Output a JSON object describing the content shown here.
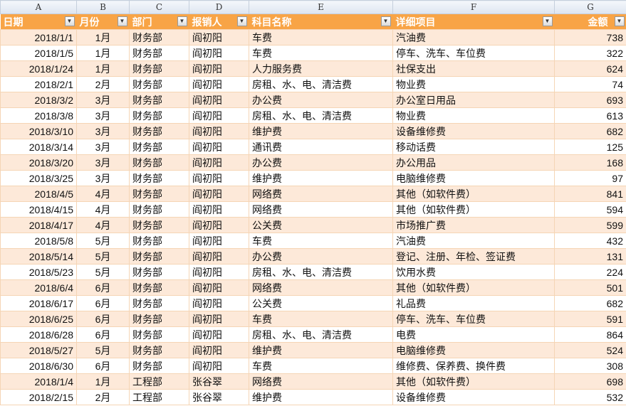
{
  "column_letters": [
    "A",
    "B",
    "C",
    "D",
    "E",
    "F",
    "G"
  ],
  "headers": [
    "日期",
    "月份",
    "部门",
    "报销人",
    "科目名称",
    "详细项目",
    "金额"
  ],
  "rows": [
    [
      "2018/1/1",
      "1月",
      "财务部",
      "阎初阳",
      "车费",
      "汽油费",
      "738"
    ],
    [
      "2018/1/5",
      "1月",
      "财务部",
      "阎初阳",
      "车费",
      "停车、洗车、车位费",
      "322"
    ],
    [
      "2018/1/24",
      "1月",
      "财务部",
      "阎初阳",
      "人力服务费",
      "社保支出",
      "624"
    ],
    [
      "2018/2/1",
      "2月",
      "财务部",
      "阎初阳",
      "房租、水、电、清洁费",
      "物业费",
      "74"
    ],
    [
      "2018/3/2",
      "3月",
      "财务部",
      "阎初阳",
      "办公费",
      "办公室日用品",
      "693"
    ],
    [
      "2018/3/8",
      "3月",
      "财务部",
      "阎初阳",
      "房租、水、电、清洁费",
      "物业费",
      "613"
    ],
    [
      "2018/3/10",
      "3月",
      "财务部",
      "阎初阳",
      "维护费",
      "设备维修费",
      "682"
    ],
    [
      "2018/3/14",
      "3月",
      "财务部",
      "阎初阳",
      "通讯费",
      "移动话费",
      "125"
    ],
    [
      "2018/3/20",
      "3月",
      "财务部",
      "阎初阳",
      "办公费",
      "办公用品",
      "168"
    ],
    [
      "2018/3/25",
      "3月",
      "财务部",
      "阎初阳",
      "维护费",
      "电脑维修费",
      "97"
    ],
    [
      "2018/4/5",
      "4月",
      "财务部",
      "阎初阳",
      "网络费",
      "其他（如软件费）",
      "841"
    ],
    [
      "2018/4/15",
      "4月",
      "财务部",
      "阎初阳",
      "网络费",
      "其他（如软件费）",
      "594"
    ],
    [
      "2018/4/17",
      "4月",
      "财务部",
      "阎初阳",
      "公关费",
      "市场推广费",
      "599"
    ],
    [
      "2018/5/8",
      "5月",
      "财务部",
      "阎初阳",
      "车费",
      "汽油费",
      "432"
    ],
    [
      "2018/5/14",
      "5月",
      "财务部",
      "阎初阳",
      "办公费",
      "登记、注册、年检、签证费",
      "131"
    ],
    [
      "2018/5/23",
      "5月",
      "财务部",
      "阎初阳",
      "房租、水、电、清洁费",
      "饮用水费",
      "224"
    ],
    [
      "2018/6/4",
      "6月",
      "财务部",
      "阎初阳",
      "网络费",
      "其他（如软件费）",
      "501"
    ],
    [
      "2018/6/17",
      "6月",
      "财务部",
      "阎初阳",
      "公关费",
      "礼品费",
      "682"
    ],
    [
      "2018/6/25",
      "6月",
      "财务部",
      "阎初阳",
      "车费",
      "停车、洗车、车位费",
      "591"
    ],
    [
      "2018/6/28",
      "6月",
      "财务部",
      "阎初阳",
      "房租、水、电、清洁费",
      "电费",
      "864"
    ],
    [
      "2018/5/27",
      "5月",
      "财务部",
      "阎初阳",
      "维护费",
      "电脑维修费",
      "524"
    ],
    [
      "2018/6/30",
      "6月",
      "财务部",
      "阎初阳",
      "车费",
      "维修费、保养费、换件费",
      "308"
    ],
    [
      "2018/1/4",
      "1月",
      "工程部",
      "张谷翠",
      "网络费",
      "其他（如软件费）",
      "698"
    ],
    [
      "2018/2/15",
      "2月",
      "工程部",
      "张谷翠",
      "维护费",
      "设备维修费",
      "532"
    ]
  ],
  "colors": {
    "header": "#f8a446",
    "band": "#fde9d9"
  }
}
